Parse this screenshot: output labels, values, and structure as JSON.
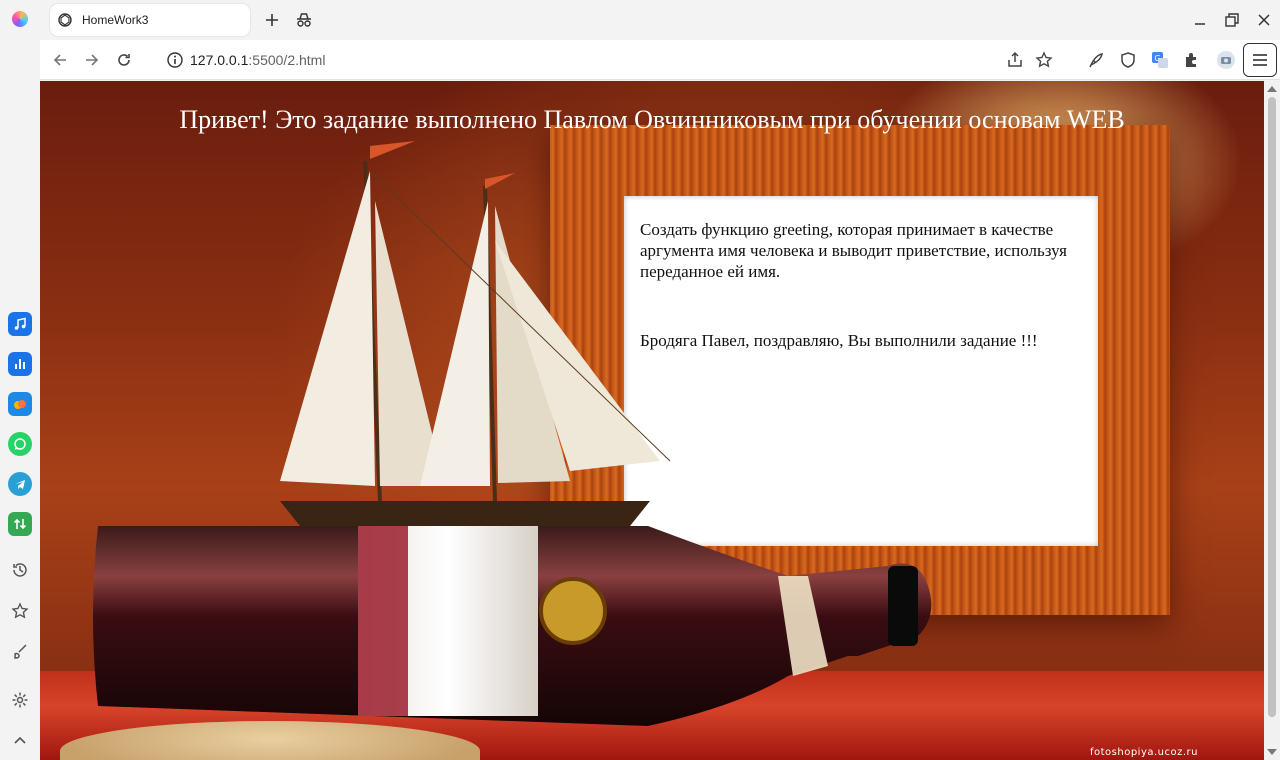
{
  "browser": {
    "tab_title": "HomeWork3",
    "url_host": "127.0.0.1",
    "url_rest": ":5500/2.html"
  },
  "page": {
    "heading": "Привет! Это задание выполнено Павлом Овчинниковым при обучении основам WEB",
    "task": "Создать функцию greeting, которая принимает в качестве аргумента имя человека и выводит приветствие, используя переданное ей имя.",
    "result": "Бродяга Павел, поздравляю, Вы выполнили задание !!!",
    "watermark": "fotoshopiya.ucoz.ru"
  },
  "icons": {
    "sidebar_apps": [
      "music-icon",
      "analytics-icon",
      "cloud-icon",
      "whatsapp-icon",
      "telegram-icon",
      "transfer-icon"
    ],
    "sidebar_tools": [
      "history-icon",
      "bookmark-star-icon",
      "brush-icon",
      "settings-icon",
      "collapse-icon"
    ]
  },
  "colors": {
    "music": "#1a73e8",
    "analytics": "#1a73e8",
    "cloud": "#1e88e5",
    "whatsapp": "#25d366",
    "telegram": "#2a9fd6",
    "transfer": "#34a853"
  }
}
